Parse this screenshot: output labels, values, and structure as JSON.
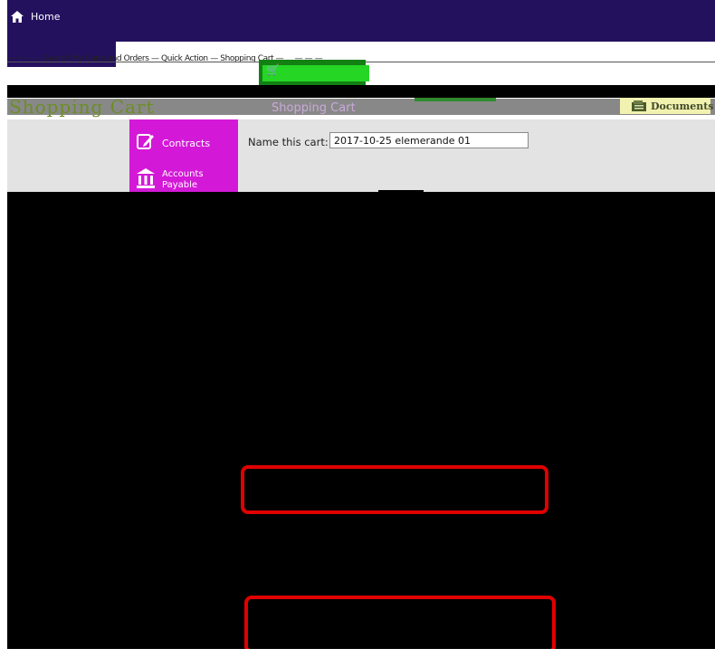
{
  "topbar": {
    "home_label": "Home",
    "home_icon": "home-icon"
  },
  "menubar": {
    "garbled_text": "— • — — Search My Carts and Orders  — Quick Action  —  Shopping Cart  —  ...  — — —"
  },
  "title": {
    "shopping_cart": "Shopping Cart",
    "documents_label": "Documents",
    "documents_icon": "document-icon"
  },
  "sidebar": {
    "items": [
      {
        "label": "Contracts",
        "icon": "edit-icon"
      },
      {
        "label": "Accounts Payable",
        "icon": "bank-icon"
      }
    ]
  },
  "form": {
    "name_label": "Name this cart:",
    "name_value": "2017-10-25 elemerande 01"
  },
  "colors": {
    "navy": "#24115e",
    "magenta": "#d319d7",
    "green": "#138013",
    "red_annotation": "#e00000"
  }
}
